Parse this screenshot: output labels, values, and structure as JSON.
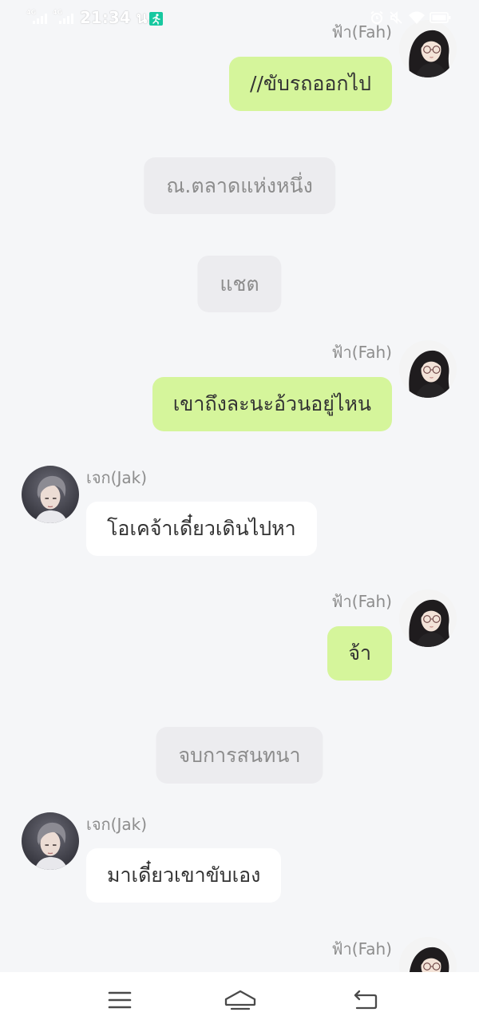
{
  "status_bar": {
    "time": "21:34 น.",
    "network_labels": [
      "4G",
      "4G"
    ],
    "icons": [
      "signal-icon",
      "signal-icon",
      "app-notification-icon",
      "alarm-icon",
      "mute-icon",
      "wifi-icon",
      "battery-icon"
    ]
  },
  "characters": {
    "fah": {
      "name": "ฟ้า(Fah)",
      "avatar": "fah-avatar",
      "side": "right"
    },
    "jak": {
      "name": "เจก(Jak)",
      "avatar": "jak-avatar",
      "side": "left"
    }
  },
  "messages": [
    {
      "kind": "outgoing",
      "sender": "ฟ้า(Fah)",
      "text": "//ขับรถออกไป"
    },
    {
      "kind": "system",
      "text": "ณ.ตลาดแห่งหนึ่ง"
    },
    {
      "kind": "system",
      "text": "แชต"
    },
    {
      "kind": "outgoing",
      "sender": "ฟ้า(Fah)",
      "text": "เขาถึงละนะอ้วนอยู่ไหน"
    },
    {
      "kind": "incoming",
      "sender": "เจก(Jak)",
      "text": "โอเคจ้าเดี๋ยวเดินไปหา"
    },
    {
      "kind": "outgoing",
      "sender": "ฟ้า(Fah)",
      "text": "จ้า"
    },
    {
      "kind": "system",
      "text": "จบการสนทนา"
    },
    {
      "kind": "incoming",
      "sender": "เจก(Jak)",
      "text": "มาเดี๋ยวเขาขับเอง"
    },
    {
      "kind": "outgoing",
      "sender": "ฟ้า(Fah)"
    }
  ],
  "nav": {
    "buttons": [
      {
        "icon": "menu-icon"
      },
      {
        "icon": "home-icon"
      },
      {
        "icon": "back-icon"
      }
    ]
  },
  "colors": {
    "background": "#f5f6f8",
    "outgoing_bubble": "#d5f59b",
    "incoming_bubble": "#ffffff",
    "system_bubble": "#ececef",
    "name_text": "#8d8d8d",
    "message_text": "#333333",
    "system_text": "#8c8c8c",
    "nav_bar": "#ffffff",
    "nav_icon": "#4a4a4a",
    "app_icon": "#17c8a0"
  }
}
